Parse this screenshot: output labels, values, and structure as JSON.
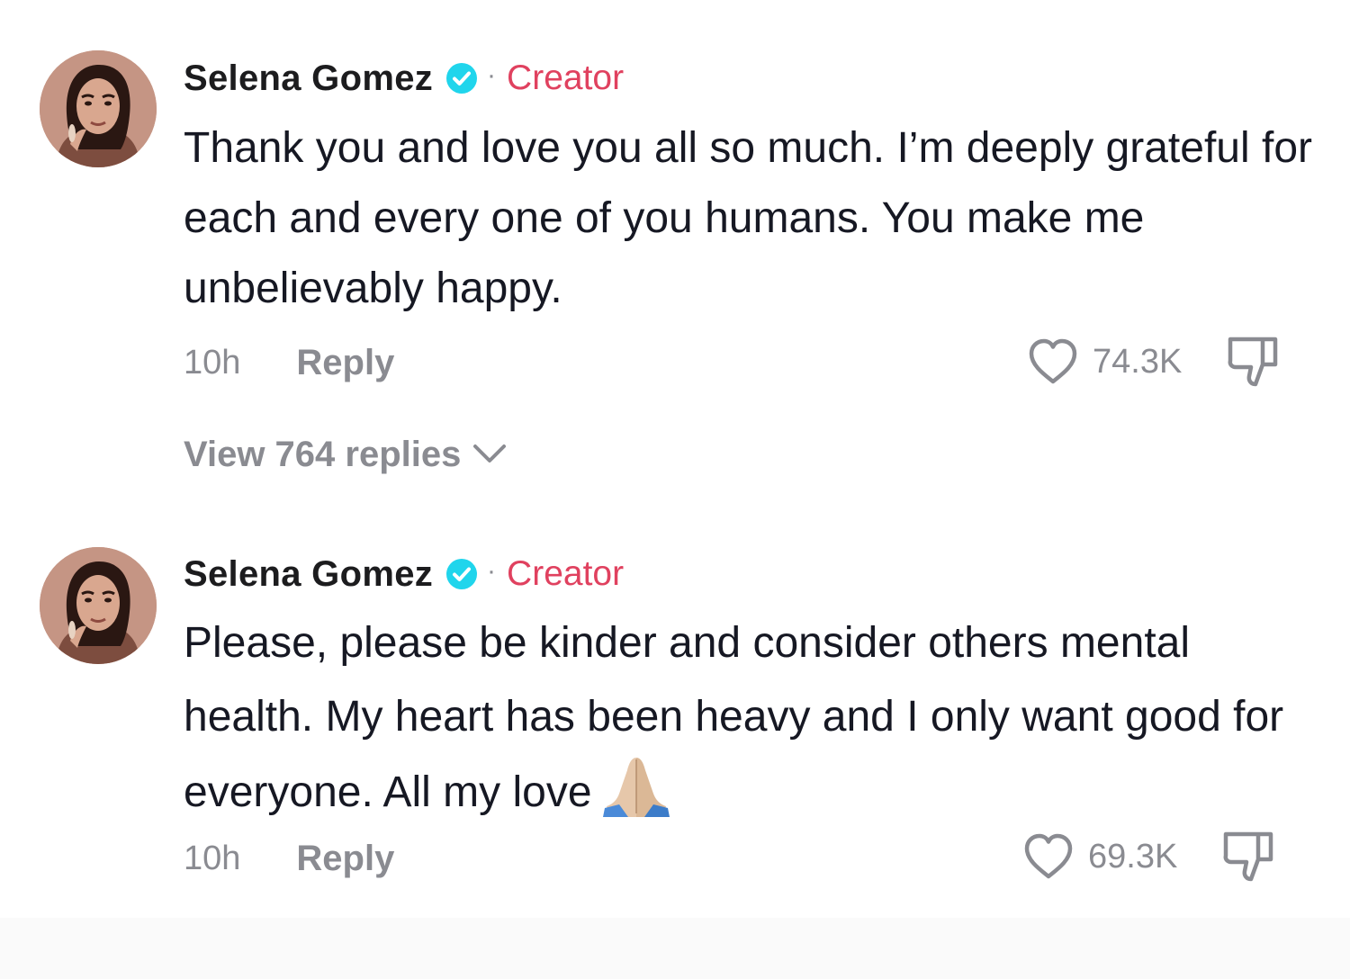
{
  "comments": [
    {
      "author": "Selena Gomez",
      "verified": true,
      "badge": "Creator",
      "text": "Thank you and love you all so much. I’m deeply grateful for each and every one of you humans. You make me unbelievably happy.",
      "time": "10h",
      "reply_label": "Reply",
      "like_count": "74.3K",
      "view_replies": "View 764 replies"
    },
    {
      "author": "Selena Gomez",
      "verified": true,
      "badge": "Creator",
      "text": "Please, please be kinder and consider others mental health. My heart has been heavy and I only want good for everyone. All my love",
      "emoji": "folded-hands",
      "time": "10h",
      "reply_label": "Reply",
      "like_count": "69.3K"
    }
  ],
  "icons": {
    "verified": "verified-badge-icon",
    "like": "heart-icon",
    "dislike": "thumbs-down-icon",
    "expand": "chevron-down-icon"
  },
  "colors": {
    "text_primary": "#161823",
    "text_secondary": "#8a8b91",
    "creator_badge": "#e0415f",
    "verified_badge": "#20d5ec",
    "background": "#ffffff"
  }
}
